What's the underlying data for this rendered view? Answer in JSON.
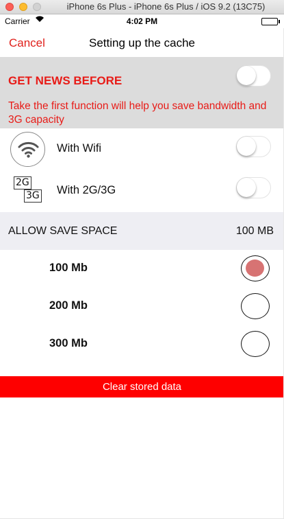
{
  "window": {
    "title": "iPhone 6s Plus - iPhone 6s Plus / iOS 9.2 (13C75)"
  },
  "status_bar": {
    "carrier": "Carrier",
    "time": "4:02 PM"
  },
  "nav": {
    "cancel_label": "Cancel",
    "title": "Setting up the cache"
  },
  "news": {
    "heading": "GET NEWS BEFORE",
    "description": "Take the first function will help you save bandwidth and 3G capacity",
    "toggle_on": false
  },
  "network": {
    "wifi": {
      "label": "With Wifi",
      "toggle_on": false
    },
    "mobile": {
      "label": "With 2G/3G",
      "toggle_on": false,
      "icon_text_a": "2G",
      "icon_text_b": "3G"
    }
  },
  "space": {
    "label": "ALLOW SAVE SPACE",
    "value": "100 MB"
  },
  "options": [
    {
      "label": "100 Mb",
      "selected": true
    },
    {
      "label": "200 Mb",
      "selected": false
    },
    {
      "label": "300 Mb",
      "selected": false
    }
  ],
  "clear_button": {
    "label": "Clear stored data"
  },
  "colors": {
    "accent_red": "#e81b17",
    "button_red": "#fe0000",
    "selected_dot": "#d77373",
    "section_gray": "#dcdcdc"
  }
}
